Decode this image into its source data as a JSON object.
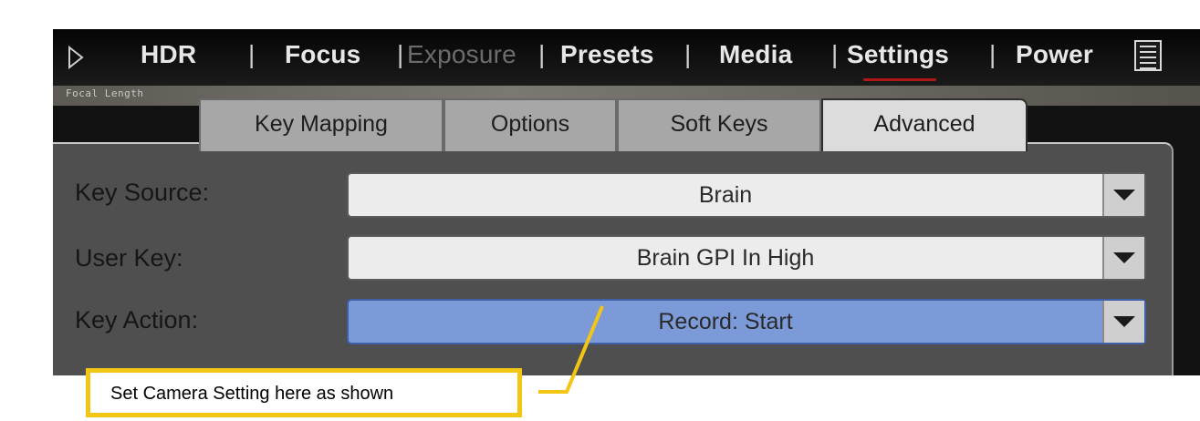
{
  "menu": {
    "items": [
      {
        "label": "HDR"
      },
      {
        "label": "Focus"
      },
      {
        "label": "Exposure"
      },
      {
        "label": "Presets"
      },
      {
        "label": "Media"
      },
      {
        "label": "Settings"
      },
      {
        "label": "Power"
      }
    ],
    "separator": "|",
    "active": "Settings",
    "disabled": "Exposure"
  },
  "focal_length_label": "Focal Length",
  "tabs": [
    {
      "label": "Key Mapping"
    },
    {
      "label": "Options"
    },
    {
      "label": "Soft Keys"
    },
    {
      "label": "Advanced"
    }
  ],
  "active_tab": "Advanced",
  "rows": [
    {
      "label": "Key Source:",
      "value": "Brain"
    },
    {
      "label": "User Key:",
      "value": "Brain GPI In High"
    },
    {
      "label": "Key Action:",
      "value": "Record: Start"
    }
  ],
  "selected_row": "Key Action:",
  "callout": {
    "text": "Set Camera Setting here as shown"
  },
  "colors": {
    "screen_bg": "#121212",
    "menu_text": "#e7e7e7",
    "settings_underline": "#b01818",
    "panel_bg": "#4f4f4f",
    "field_bg": "#ececec",
    "selected_field_bg": "#7d9ad8",
    "callout_border": "#f3c614"
  },
  "icons": [
    "play-icon",
    "list-icon",
    "dropdown-arrow-icon"
  ]
}
